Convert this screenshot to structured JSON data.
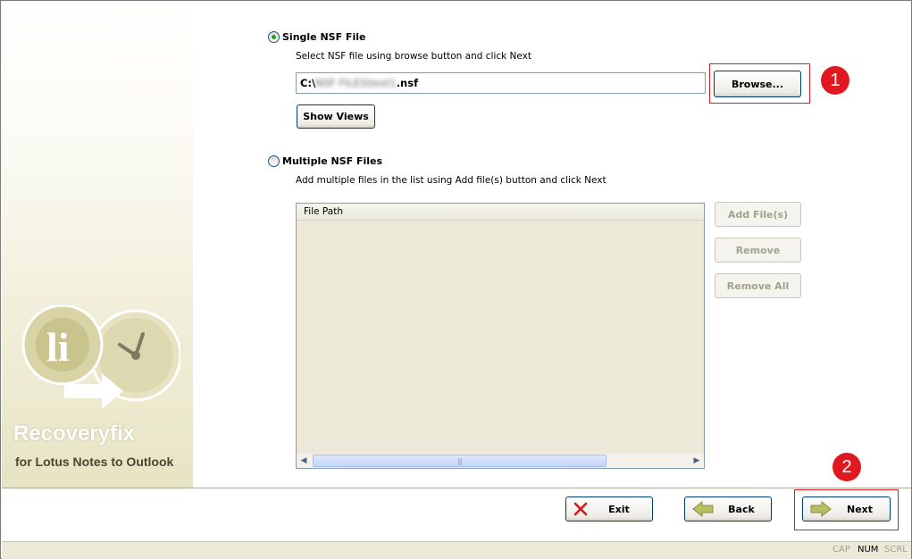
{
  "sidebar": {
    "brand_name": "Recoveryfix",
    "brand_subtitle": "for Lotus Notes to Outlook"
  },
  "single": {
    "option_label": "Single NSF File",
    "hint": "Select NSF file using browse button and click Next",
    "path_prefix": "C:\\",
    "path_blurred": "NSF FILES\\test1",
    "path_suffix": ".nsf",
    "browse_label": "Browse...",
    "show_views_label": "Show Views"
  },
  "multiple": {
    "option_label": "Multiple NSF Files",
    "hint": "Add multiple files in the list using Add file(s) button and click Next",
    "column_header": "File Path",
    "add_label": "Add File(s)",
    "remove_label": "Remove",
    "remove_all_label": "Remove All"
  },
  "annotations": {
    "step1": "1",
    "step2": "2"
  },
  "footer": {
    "exit_label": "Exit",
    "back_label": "Back",
    "next_label": "Next"
  },
  "status": {
    "cap": "CAP",
    "num": "NUM",
    "scrl": "SCRL"
  },
  "colors": {
    "highlight_border": "#e31b23",
    "badge": "#e01820",
    "radio_selected": "#21a121"
  },
  "icons": {
    "exit": "red-x-icon",
    "back": "back-arrow-icon",
    "next": "next-arrow-icon"
  }
}
